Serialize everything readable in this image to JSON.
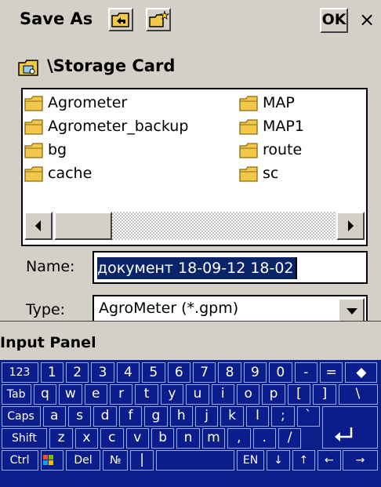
{
  "dialog": {
    "title": "Save As",
    "up_button_icon": "folder-up-icon",
    "new_folder_button_icon": "new-folder-icon",
    "ok_label": "OK",
    "close_label": "×"
  },
  "path": {
    "icon": "storage-card-icon",
    "text": "\\Storage Card"
  },
  "files": {
    "items": [
      "Agrometer",
      "Agrometer_backup",
      "bg",
      "cache",
      "MAP",
      "MAP1",
      "route",
      "sc"
    ]
  },
  "name_field": {
    "label": "Name:",
    "value": "документ 18-09-12 18-02"
  },
  "type_field": {
    "label": "Type:",
    "value": "AgroMeter (*.gpm)"
  },
  "input_panel": {
    "title": "Input Panel",
    "rows": [
      [
        "123",
        "1",
        "2",
        "3",
        "4",
        "5",
        "6",
        "7",
        "8",
        "9",
        "0",
        "-",
        "=",
        "◆"
      ],
      [
        "Tab",
        "q",
        "w",
        "e",
        "r",
        "t",
        "y",
        "u",
        "i",
        "o",
        "p",
        "[",
        "]",
        "\\"
      ],
      [
        "Caps",
        "a",
        "s",
        "d",
        "f",
        "g",
        "h",
        "j",
        "k",
        "l",
        ";",
        "`"
      ],
      [
        "Shift",
        "z",
        "x",
        "c",
        "v",
        "b",
        "n",
        "m",
        ",",
        ".",
        "/"
      ],
      [
        "Ctrl",
        "",
        "Del",
        "№",
        "|",
        "",
        "EN",
        "↓",
        "↑",
        "←",
        "→"
      ]
    ]
  },
  "colors": {
    "dialog_bg": "#d4d0c8",
    "selection": "#0a246a",
    "keyboard_bg": "#0c1e8a",
    "folder": "#f2c84b"
  }
}
